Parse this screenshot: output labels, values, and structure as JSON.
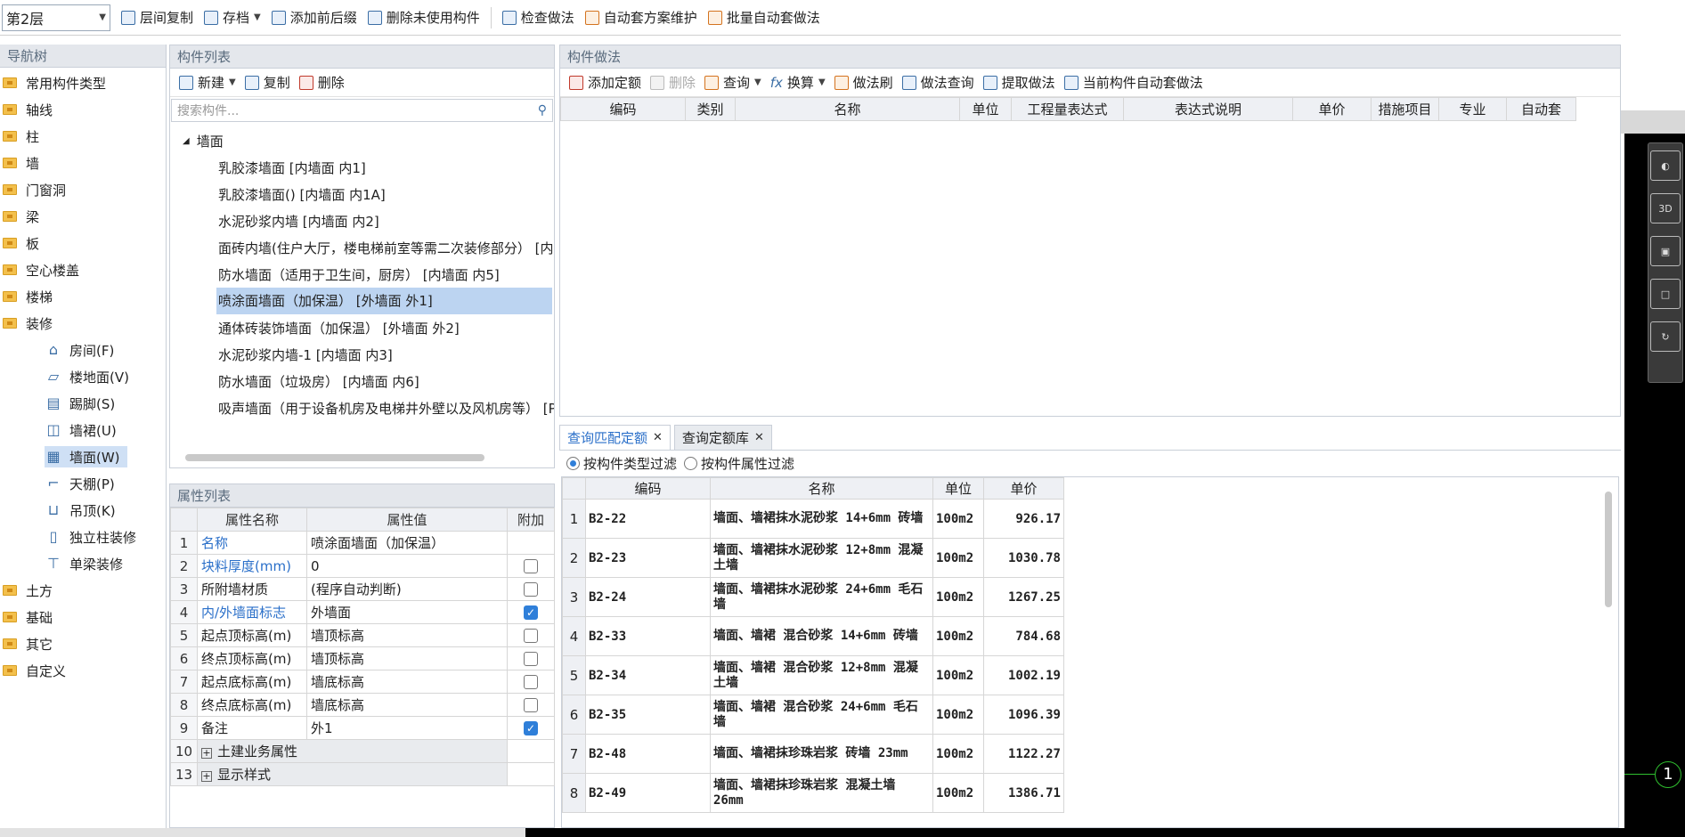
{
  "toolbar": {
    "floor": "第2层",
    "items": [
      "层间复制",
      "存档",
      "添加前后缀",
      "删除未使用构件",
      "检查做法",
      "自动套方案维护",
      "批量自动套做法"
    ]
  },
  "nav": {
    "title": "导航树",
    "items": [
      "常用构件类型",
      "轴线",
      "柱",
      "墙",
      "门窗洞",
      "梁",
      "板",
      "空心楼盖",
      "楼梯",
      "装修"
    ],
    "sub_items": [
      "房间(F)",
      "楼地面(V)",
      "踢脚(S)",
      "墙裙(U)",
      "墙面(W)",
      "天棚(P)",
      "吊顶(K)",
      "独立柱装修",
      "单梁装修"
    ],
    "bottom_items": [
      "土方",
      "基础",
      "其它",
      "自定义"
    ]
  },
  "components": {
    "title": "构件列表",
    "new": "新建",
    "copy": "复制",
    "delete": "删除",
    "search_placeholder": "搜索构件...",
    "group": "墙面",
    "items": [
      "乳胶漆墙面 [内墙面 内1]",
      "乳胶漆墙面() [内墙面 内1A]",
      "水泥砂浆内墙 [内墙面 内2]",
      "面砖内墙(住户大厅，楼电梯前室等需二次装修部分） [内",
      "防水墙面（适用于卫生间，厨房） [内墙面 内5]",
      "喷涂面墙面（加保温） [外墙面 外1]",
      "通体砖装饰墙面（加保温） [外墙面 外2]",
      "水泥砂浆内墙-1 [内墙面 内3]",
      "防水墙面（垃圾房） [内墙面 内6]",
      "吸声墙面（用于设备机房及电梯井外壁以及风机房等） [P"
    ]
  },
  "properties": {
    "title": "属性列表",
    "headers": [
      "属性名称",
      "属性值",
      "附加"
    ],
    "rows": [
      {
        "n": "1",
        "name": "名称",
        "value": "喷涂面墙面（加保温）"
      },
      {
        "n": "2",
        "name": "块料厚度(mm)",
        "value": "0"
      },
      {
        "n": "3",
        "name": "所附墙材质",
        "value": "(程序自动判断)"
      },
      {
        "n": "4",
        "name": "内/外墙面标志",
        "value": "外墙面"
      },
      {
        "n": "5",
        "name": "起点顶标高(m)",
        "value": "墙顶标高"
      },
      {
        "n": "6",
        "name": "终点顶标高(m)",
        "value": "墙顶标高"
      },
      {
        "n": "7",
        "name": "起点底标高(m)",
        "value": "墙底标高"
      },
      {
        "n": "8",
        "name": "终点底标高(m)",
        "value": "墙底标高"
      },
      {
        "n": "9",
        "name": "备注",
        "value": "外1"
      },
      {
        "n": "10",
        "name": "土建业务属性",
        "value": ""
      },
      {
        "n": "13",
        "name": "显示样式",
        "value": ""
      }
    ],
    "checked": [
      false,
      true,
      false,
      true,
      false,
      false,
      false,
      false,
      true
    ]
  },
  "method": {
    "title": "构件做法",
    "toolbar": [
      "添加定额",
      "删除",
      "查询",
      "换算",
      "做法刷",
      "做法查询",
      "提取做法",
      "当前构件自动套做法"
    ],
    "headers": [
      "编码",
      "类别",
      "名称",
      "单位",
      "工程量表达式",
      "表达式说明",
      "单价",
      "措施项目",
      "专业",
      "自动套"
    ]
  },
  "tabs": [
    "查询匹配定额",
    "查询定额库"
  ],
  "filter": [
    "按构件类型过滤",
    "按构件属性过滤"
  ],
  "quota": {
    "headers": [
      "编码",
      "名称",
      "单位",
      "单价"
    ],
    "rows": [
      {
        "n": "1",
        "code": "B2-22",
        "name": "墙面、墙裙抹水泥砂浆 14+6mm 砖墙",
        "unit": "100m2",
        "price": "926.17"
      },
      {
        "n": "2",
        "code": "B2-23",
        "name": "墙面、墙裙抹水泥砂浆 12+8mm 混凝土墙",
        "unit": "100m2",
        "price": "1030.78"
      },
      {
        "n": "3",
        "code": "B2-24",
        "name": "墙面、墙裙抹水泥砂浆 24+6mm 毛石墙",
        "unit": "100m2",
        "price": "1267.25"
      },
      {
        "n": "4",
        "code": "B2-33",
        "name": "墙面、墙裙 混合砂浆 14+6mm 砖墙",
        "unit": "100m2",
        "price": "784.68"
      },
      {
        "n": "5",
        "code": "B2-34",
        "name": "墙面、墙裙 混合砂浆 12+8mm 混凝土墙",
        "unit": "100m2",
        "price": "1002.19"
      },
      {
        "n": "6",
        "code": "B2-35",
        "name": "墙面、墙裙 混合砂浆 24+6mm 毛石墙",
        "unit": "100m2",
        "price": "1096.39"
      },
      {
        "n": "7",
        "code": "B2-48",
        "name": "墙面、墙裙抹珍珠岩浆 砖墙 23mm",
        "unit": "100m2",
        "price": "1122.27"
      },
      {
        "n": "8",
        "code": "B2-49",
        "name": "墙面、墙裙抹珍珠岩浆 混凝土墙 26mm",
        "unit": "100m2",
        "price": "1386.71"
      }
    ]
  },
  "viewport": {
    "axis_label": "1",
    "view_3d": "3D"
  }
}
